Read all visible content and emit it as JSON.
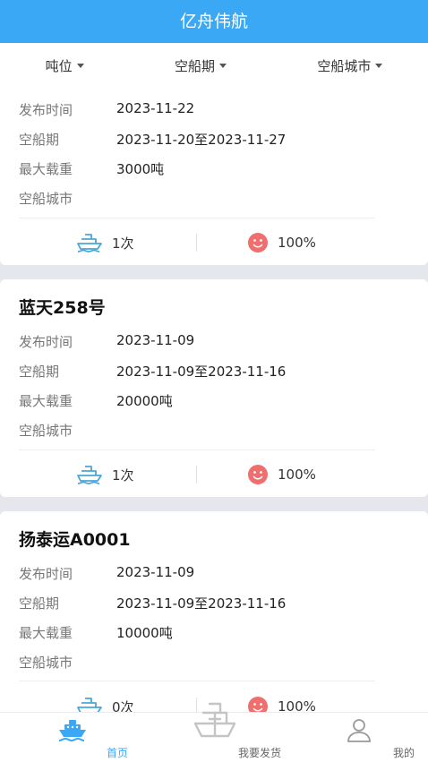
{
  "app": {
    "title": "亿舟伟航"
  },
  "filters": [
    {
      "label": "吨位"
    },
    {
      "label": "空船期"
    },
    {
      "label": "空船城市"
    }
  ],
  "field_labels": {
    "publish_time": "发布时间",
    "empty_period": "空船期",
    "max_load": "最大载重",
    "empty_city": "空船城市"
  },
  "cards": [
    {
      "name": "",
      "publish_time": "2023-11-22",
      "empty_period": "2023-11-20至2023-11-27",
      "max_load": "3000吨",
      "empty_city": "",
      "trips": "1次",
      "rate": "100%"
    },
    {
      "name": "蓝天258号",
      "publish_time": "2023-11-09",
      "empty_period": "2023-11-09至2023-11-16",
      "max_load": "20000吨",
      "empty_city": "",
      "trips": "1次",
      "rate": "100%"
    },
    {
      "name": "扬泰运A0001",
      "publish_time": "2023-11-09",
      "empty_period": "2023-11-09至2023-11-16",
      "max_load": "10000吨",
      "empty_city": "",
      "trips": "0次",
      "rate": "100%"
    }
  ],
  "tabs": [
    {
      "label": "首页",
      "icon": "ship-home-icon",
      "active": true
    },
    {
      "label": "我要发货",
      "icon": "cargo-ship-icon",
      "active": false
    },
    {
      "label": "我的",
      "icon": "user-icon",
      "active": false
    }
  ],
  "colors": {
    "accent": "#3aa8f4",
    "ship_icon": "#4aa6d8",
    "smile_icon": "#ef6e6e"
  }
}
